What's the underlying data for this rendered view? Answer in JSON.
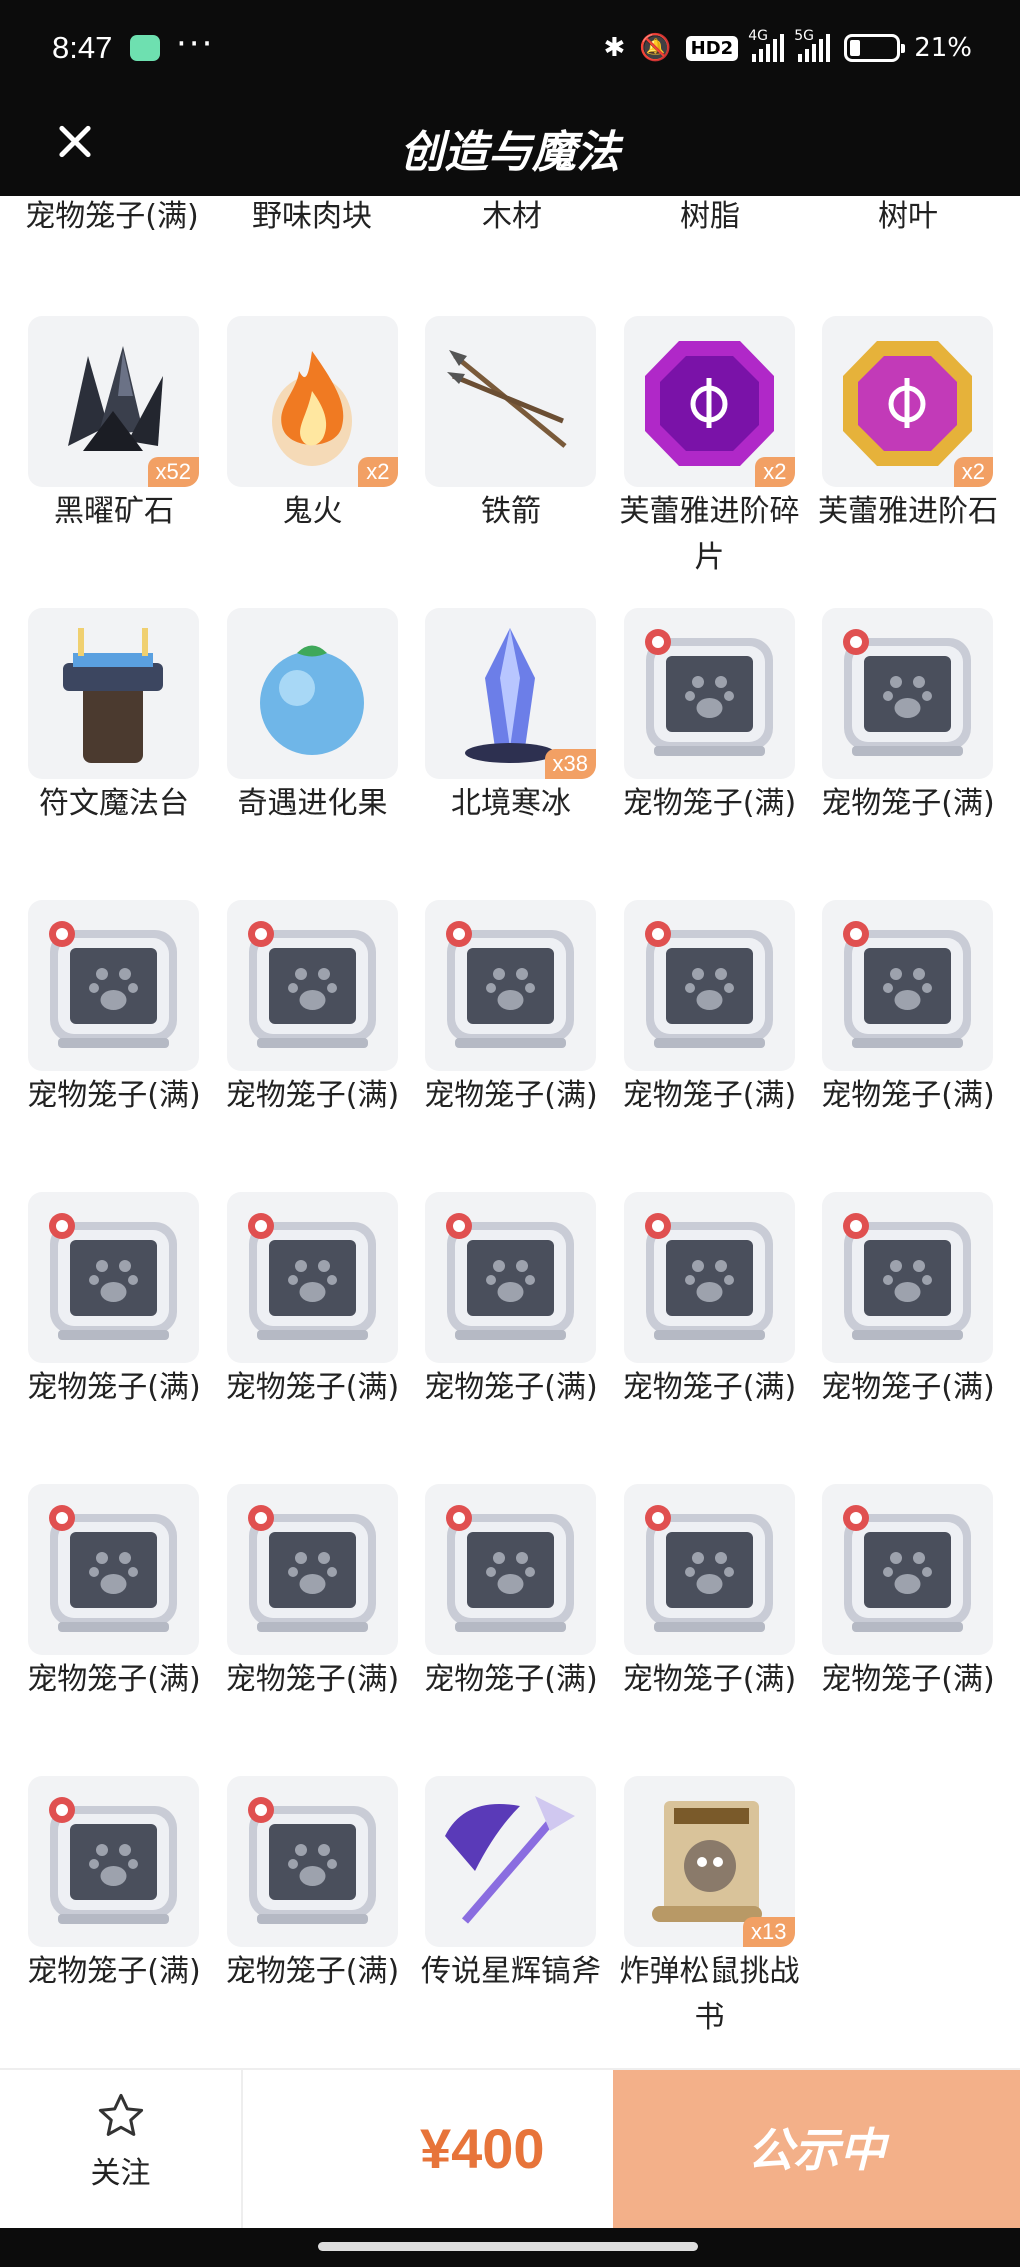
{
  "status_bar": {
    "time": "8:47",
    "more": "···",
    "hd": "HD2",
    "net1": "4G",
    "net2": "5G",
    "battery": "21%"
  },
  "header": {
    "title": "创造与魔法"
  },
  "top_row": [
    "宠物笼子(满)",
    "野味肉块",
    "木材",
    "树脂",
    "树叶"
  ],
  "items": [
    {
      "name": "黑曜矿石",
      "count": "x52",
      "icon": "obsidian-ore-icon"
    },
    {
      "name": "鬼火",
      "count": "x2",
      "icon": "ghost-fire-icon"
    },
    {
      "name": "铁箭",
      "count": "",
      "icon": "iron-arrow-icon"
    },
    {
      "name": "芙蕾雅进阶碎片",
      "count": "x2",
      "icon": "freya-fragment-icon"
    },
    {
      "name": "芙蕾雅进阶石",
      "count": "x2",
      "icon": "freya-stone-icon"
    },
    {
      "name": "符文魔法台",
      "count": "",
      "icon": "rune-altar-icon"
    },
    {
      "name": "奇遇进化果",
      "count": "",
      "icon": "evolution-fruit-icon"
    },
    {
      "name": "北境寒冰",
      "count": "x38",
      "icon": "north-ice-icon"
    },
    {
      "name": "宠物笼子(满)",
      "count": "",
      "icon": "pet-cage-icon"
    },
    {
      "name": "宠物笼子(满)",
      "count": "",
      "icon": "pet-cage-icon"
    },
    {
      "name": "宠物笼子(满)",
      "count": "",
      "icon": "pet-cage-icon"
    },
    {
      "name": "宠物笼子(满)",
      "count": "",
      "icon": "pet-cage-icon"
    },
    {
      "name": "宠物笼子(满)",
      "count": "",
      "icon": "pet-cage-icon"
    },
    {
      "name": "宠物笼子(满)",
      "count": "",
      "icon": "pet-cage-icon"
    },
    {
      "name": "宠物笼子(满)",
      "count": "",
      "icon": "pet-cage-icon"
    },
    {
      "name": "宠物笼子(满)",
      "count": "",
      "icon": "pet-cage-icon"
    },
    {
      "name": "宠物笼子(满)",
      "count": "",
      "icon": "pet-cage-icon"
    },
    {
      "name": "宠物笼子(满)",
      "count": "",
      "icon": "pet-cage-icon"
    },
    {
      "name": "宠物笼子(满)",
      "count": "",
      "icon": "pet-cage-icon"
    },
    {
      "name": "宠物笼子(满)",
      "count": "",
      "icon": "pet-cage-icon"
    },
    {
      "name": "宠物笼子(满)",
      "count": "",
      "icon": "pet-cage-icon"
    },
    {
      "name": "宠物笼子(满)",
      "count": "",
      "icon": "pet-cage-icon"
    },
    {
      "name": "宠物笼子(满)",
      "count": "",
      "icon": "pet-cage-icon"
    },
    {
      "name": "宠物笼子(满)",
      "count": "",
      "icon": "pet-cage-icon"
    },
    {
      "name": "宠物笼子(满)",
      "count": "",
      "icon": "pet-cage-icon"
    },
    {
      "name": "宠物笼子(满)",
      "count": "",
      "icon": "pet-cage-icon"
    },
    {
      "name": "宠物笼子(满)",
      "count": "",
      "icon": "pet-cage-icon"
    },
    {
      "name": "传说星辉镐斧",
      "count": "",
      "icon": "legend-pickaxe-icon"
    },
    {
      "name": "炸弹松鼠挑战书",
      "count": "x13",
      "icon": "wanted-scroll-icon"
    }
  ],
  "bottom_bar": {
    "follow_label": "关注",
    "price": "¥400",
    "action_label": "公示中"
  },
  "colors": {
    "accent": "#e7743a",
    "action_bg": "#f3b089",
    "badge": "#f2a064",
    "dark": "#0c0c0c"
  }
}
